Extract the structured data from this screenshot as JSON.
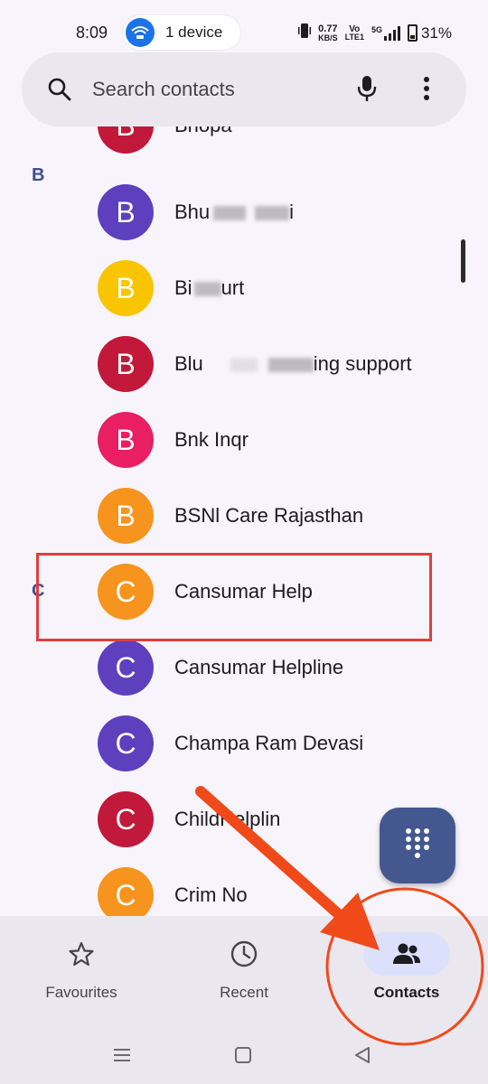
{
  "status_bar": {
    "time": "8:09",
    "device_pill": "1 device",
    "net_speed_value": "0.77",
    "net_speed_unit": "KB/S",
    "volte_top": "Vo",
    "volte_bottom": "LTE1",
    "network": "5G",
    "battery": "31%"
  },
  "search": {
    "placeholder": "Search contacts"
  },
  "sections": {
    "b": "B",
    "c": "C"
  },
  "contacts": [
    {
      "initial": "B",
      "name": "Bhopa",
      "color": "#c2183a"
    },
    {
      "initial": "B",
      "name_prefix": "Bhu",
      "name_suffix": "i",
      "color": "#5e3fbe"
    },
    {
      "initial": "B",
      "name_prefix": "Bi",
      "name_suffix": "urt",
      "color": "#f9c400"
    },
    {
      "initial": "B",
      "name_prefix": "Blu",
      "name_suffix": "ing support",
      "color": "#c2183a"
    },
    {
      "initial": "B",
      "name": "Bnk Inqr",
      "color": "#e91e63"
    },
    {
      "initial": "B",
      "name": "BSNl Care Rajasthan",
      "color": "#f7941d"
    },
    {
      "initial": "C",
      "name": "Cansumar Help",
      "color": "#f7941d"
    },
    {
      "initial": "C",
      "name": "Cansumar Helpline",
      "color": "#5e3fbe"
    },
    {
      "initial": "C",
      "name": "Champa Ram Devasi",
      "color": "#5e3fbe"
    },
    {
      "initial": "C",
      "name": "ChildHelplin",
      "color": "#c2183a"
    },
    {
      "initial": "C",
      "name": "Crim No",
      "color": "#f7941d"
    }
  ],
  "bottom_nav": {
    "favourites": "Favourites",
    "recent": "Recent",
    "contacts": "Contacts"
  },
  "colors": {
    "accent": "#44578f",
    "highlight": "#e03e3e",
    "arrow": "#f04a1a"
  }
}
